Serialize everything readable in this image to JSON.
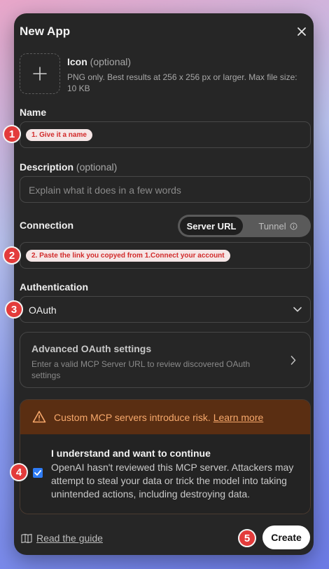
{
  "dialog": {
    "title": "New App"
  },
  "icon": {
    "label": "Icon",
    "optional": "(optional)",
    "hint": "PNG only. Best results at 256 x 256 px or larger. Max file size: 10 KB"
  },
  "name": {
    "label": "Name",
    "annotation": "1. Give it a name",
    "badge": "1"
  },
  "description": {
    "label": "Description",
    "optional": "(optional)",
    "placeholder": "Explain what it does in a few words"
  },
  "connection": {
    "label": "Connection",
    "options": [
      "Server URL",
      "Tunnel"
    ],
    "selected": "Server URL",
    "annotation": "2. Paste the link you copyed from 1.Connect your account",
    "badge": "2"
  },
  "authentication": {
    "label": "Authentication",
    "value": "OAuth",
    "badge": "3"
  },
  "advanced": {
    "title": "Advanced OAuth settings",
    "description": "Enter a valid MCP Server URL to review discovered OAuth settings"
  },
  "warning": {
    "text": "Custom MCP servers introduce risk.",
    "link": "Learn more",
    "ack_title": "I understand and want to continue",
    "ack_desc": "OpenAI hasn't reviewed this MCP server. Attackers may attempt to steal your data or trick the model into taking unintended actions, including destroying data.",
    "checked": true,
    "badge": "4"
  },
  "footer": {
    "guide": "Read the guide",
    "create": "Create",
    "badge": "5"
  },
  "colors": {
    "accent": "#2e7cf6",
    "badge": "#e33b3b",
    "warning_text": "#f7a86b",
    "warning_bg": "#5a2e12"
  }
}
